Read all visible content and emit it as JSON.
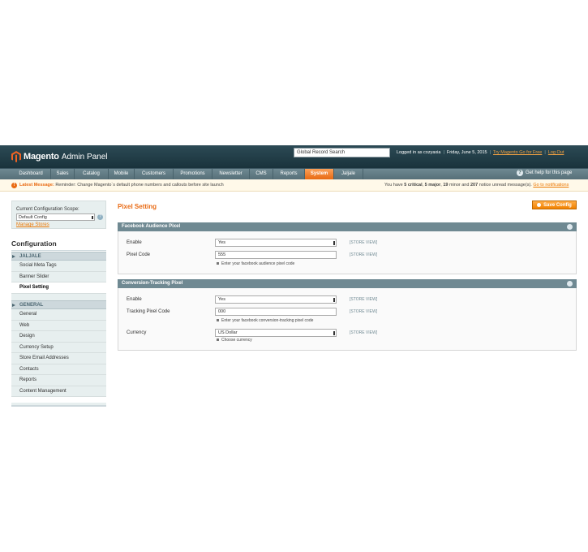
{
  "header": {
    "logo_word": "Magento",
    "logo_sub": "Admin Panel",
    "search_placeholder": "Global Record Search",
    "logged_in": "Logged in as cozyaxia",
    "date": "Friday, June 5, 2015",
    "try_go": "Try Magento Go for Free",
    "logout": "Log Out"
  },
  "nav": {
    "items": [
      "Dashboard",
      "Sales",
      "Catalog",
      "Mobile",
      "Customers",
      "Promotions",
      "Newsletter",
      "CMS",
      "Reports",
      "System",
      "Jaljale"
    ],
    "active": "System",
    "help": "Get help for this page"
  },
  "notice": {
    "label": "Latest Message:",
    "text": "Reminder: Change Magento`s default phone numbers and callouts before site launch",
    "right_prefix": "You have",
    "critical": "5 critical",
    "major": "5 major",
    "minor": "19",
    "minor_suffix": "minor and",
    "notice_count": "207",
    "right_suffix": "notice unread message(s).",
    "link": "Go to notifications"
  },
  "scope": {
    "label": "Current Configuration Scope:",
    "value": "Default Config",
    "manage": "Manage Stores"
  },
  "sidebar": {
    "title": "Configuration",
    "groups": [
      {
        "label": "JALJALE",
        "items": [
          "Social Meta Tags",
          "Banner Slider",
          "Pixel Setting"
        ]
      },
      {
        "label": "GENERAL",
        "items": [
          "General",
          "Web",
          "Design",
          "Currency Setup",
          "Store Email Addresses",
          "Contacts",
          "Reports",
          "Content Management"
        ]
      }
    ],
    "active": "Pixel Setting"
  },
  "main": {
    "title": "Pixel Setting",
    "save": "Save Config",
    "sections": [
      {
        "title": "Facebook Audience Pixel",
        "rows": [
          {
            "label": "Enable",
            "value": "Yes",
            "scope": "[STORE VIEW]"
          },
          {
            "label": "Pixel Code",
            "value": "555",
            "scope": "[STORE VIEW]",
            "note": "Enter your facebook audience pixel code"
          }
        ]
      },
      {
        "title": "Conversion-Tracking Pixel",
        "rows": [
          {
            "label": "Enable",
            "value": "Yes",
            "scope": "[STORE VIEW]"
          },
          {
            "label": "Tracking Pixel Code",
            "value": "000",
            "scope": "[STORE VIEW]",
            "note": "Enter your facebook conversion-tracking pixel code"
          },
          {
            "label": "Currency",
            "value": "US Dollar",
            "scope": "[STORE VIEW]",
            "note": "Choose currency"
          }
        ]
      }
    ]
  }
}
